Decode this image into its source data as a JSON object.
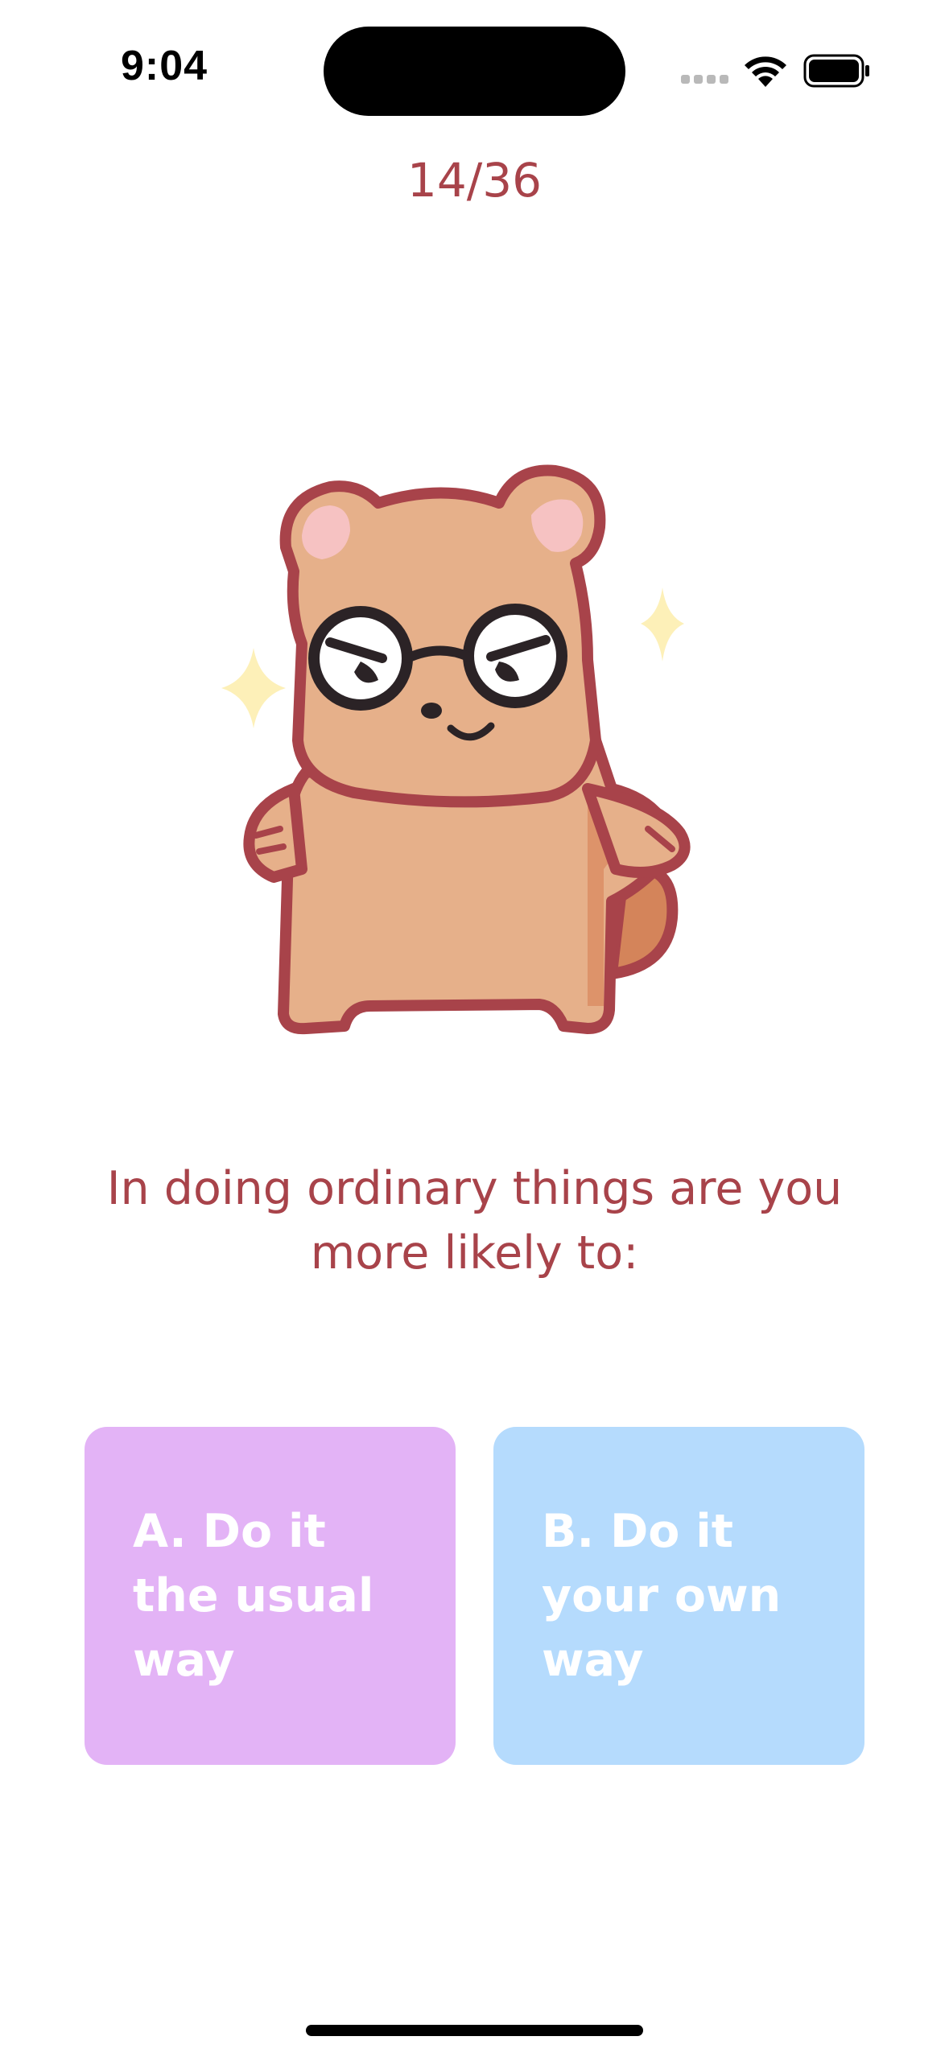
{
  "status_bar": {
    "time": "9:04"
  },
  "quiz": {
    "progress": "14/36",
    "current_question": 14,
    "total_questions": 36,
    "question": "In doing ordinary things are you more likely to:",
    "options": [
      {
        "label": "A. Do it the usual way"
      },
      {
        "label": "B. Do it your own way"
      }
    ]
  },
  "colors": {
    "accent_text": "#a8434a",
    "option_a_bg": "#e3b3f6",
    "option_b_bg": "#b5dbfd",
    "option_text": "#ffffff"
  },
  "icons": {
    "mascot": "bear-with-glasses-illustration",
    "status": [
      "cellular-signal-icon",
      "wifi-icon",
      "battery-icon"
    ]
  }
}
